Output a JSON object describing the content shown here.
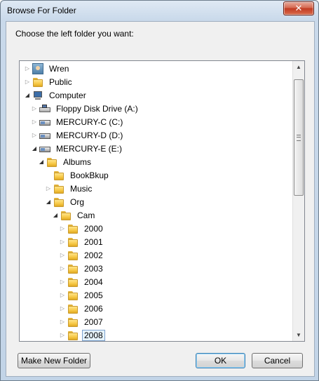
{
  "window": {
    "title": "Browse For Folder",
    "close_glyph": "✕"
  },
  "prompt": "Choose the left folder you want:",
  "tree": {
    "nodes": [
      {
        "label": "Wren",
        "icon": "user-icon",
        "state": "collapsed"
      },
      {
        "label": "Public",
        "icon": "folder-icon",
        "state": "collapsed"
      },
      {
        "label": "Computer",
        "icon": "computer-icon",
        "state": "expanded"
      },
      {
        "label": "Floppy Disk Drive (A:)",
        "icon": "floppy-icon",
        "state": "collapsed"
      },
      {
        "label": "MERCURY-C (C:)",
        "icon": "drive-icon",
        "state": "collapsed"
      },
      {
        "label": "MERCURY-D (D:)",
        "icon": "drive-icon",
        "state": "collapsed"
      },
      {
        "label": "MERCURY-E (E:)",
        "icon": "drive-icon",
        "state": "expanded"
      },
      {
        "label": "Albums",
        "icon": "folder-icon",
        "state": "expanded"
      },
      {
        "label": "BookBkup",
        "icon": "folder-icon",
        "state": "none"
      },
      {
        "label": "Music",
        "icon": "folder-icon",
        "state": "collapsed"
      },
      {
        "label": "Org",
        "icon": "folder-icon",
        "state": "expanded"
      },
      {
        "label": "Cam",
        "icon": "folder-icon",
        "state": "expanded"
      },
      {
        "label": "2000",
        "icon": "folder-icon",
        "state": "collapsed"
      },
      {
        "label": "2001",
        "icon": "folder-icon",
        "state": "collapsed"
      },
      {
        "label": "2002",
        "icon": "folder-icon",
        "state": "collapsed"
      },
      {
        "label": "2003",
        "icon": "folder-icon",
        "state": "collapsed"
      },
      {
        "label": "2004",
        "icon": "folder-icon",
        "state": "collapsed"
      },
      {
        "label": "2005",
        "icon": "folder-icon",
        "state": "collapsed"
      },
      {
        "label": "2006",
        "icon": "folder-icon",
        "state": "collapsed"
      },
      {
        "label": "2007",
        "icon": "folder-icon",
        "state": "collapsed"
      },
      {
        "label": "2008",
        "icon": "folder-icon",
        "state": "collapsed",
        "selected": true
      }
    ]
  },
  "buttons": {
    "make_new_folder": "Make New Folder",
    "ok": "OK",
    "cancel": "Cancel"
  }
}
